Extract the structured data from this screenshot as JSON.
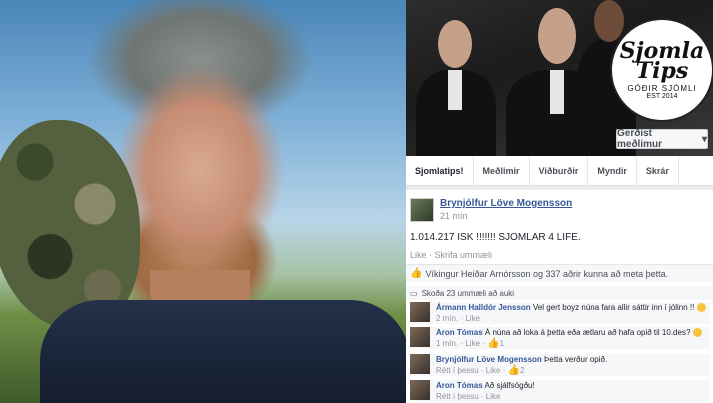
{
  "cover": {
    "logo_line1": "Sjomla",
    "logo_line2": "Tips",
    "logo_line3": "GÓÐIR SJÓMLI",
    "logo_line4": "EST 2014",
    "join_button": "Gerðist meðlimur",
    "join_caret": "▾"
  },
  "tabs": [
    "Sjomlatips!",
    "Meðlimir",
    "Viðburðir",
    "Myndir",
    "Skrár"
  ],
  "post": {
    "author": "Brynjólfur Löve Mogensson",
    "time": "21 mín",
    "text": "1.014.217 ISK !!!!!!! SJOMLAR 4 LIFE.",
    "actions": "Like · Skrifa ummæli",
    "likes": "Víkingur Heiðar Arnórsson og 337 aðrir kunna að meta þetta.",
    "view_more": "Skoða 23 ummæli að auki"
  },
  "comments": [
    {
      "name": "Ármann Halldór Jensson",
      "text": "Vel gert boyz núna fara allir sáttir inn í jólinn !!",
      "meta": "2 mín. · Like",
      "emoji": true,
      "likes": ""
    },
    {
      "name": "Aron Tómas",
      "text": "Á núna að loka á þetta eða ætlaru að hafa opið til 10.des?",
      "meta": "1 mín. · Like ·",
      "emoji": true,
      "likes": "1"
    },
    {
      "name": "Brynjólfur Löve Mogensson",
      "text": "Þetta verður opið.",
      "meta": "Rétt í þessu · Like ·",
      "emoji": false,
      "likes": "2"
    },
    {
      "name": "Aron Tómas",
      "text": "Að sjálfsögðu!",
      "meta": "Rétt í þessu · Like",
      "emoji": false,
      "likes": ""
    }
  ]
}
